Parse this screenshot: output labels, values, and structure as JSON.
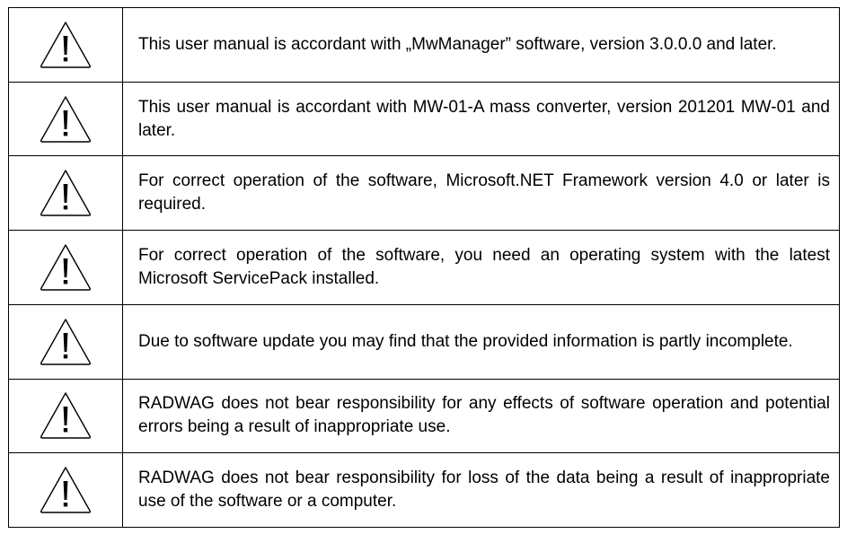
{
  "notices": [
    {
      "icon": "warning-triangle-icon",
      "text": "This user manual is accordant with „MwManager” software, version 3.0.0.0 and later."
    },
    {
      "icon": "warning-triangle-icon",
      "text": "This user manual is accordant with MW-01-A mass converter, version 201201 MW-01 and later."
    },
    {
      "icon": "warning-triangle-icon",
      "text": "For correct operation of the software, Microsoft.NET Framework version 4.0 or later is required."
    },
    {
      "icon": "warning-triangle-icon",
      "text": "For correct operation of the software, you need an operating system with the latest Microsoft ServicePack installed."
    },
    {
      "icon": "warning-triangle-icon",
      "text": "Due to software update you may find that the provided information is partly incomplete."
    },
    {
      "icon": "warning-triangle-icon",
      "text": "RADWAG does not bear responsibility for any effects of software operation and potential errors being a result of inappropriate use."
    },
    {
      "icon": "warning-triangle-icon",
      "text": "RADWAG does not bear responsibility for loss of the data being a result of inappropriate use of the software or a computer."
    }
  ],
  "colors": {
    "border": "#000000",
    "text": "#000000",
    "background": "#ffffff"
  }
}
